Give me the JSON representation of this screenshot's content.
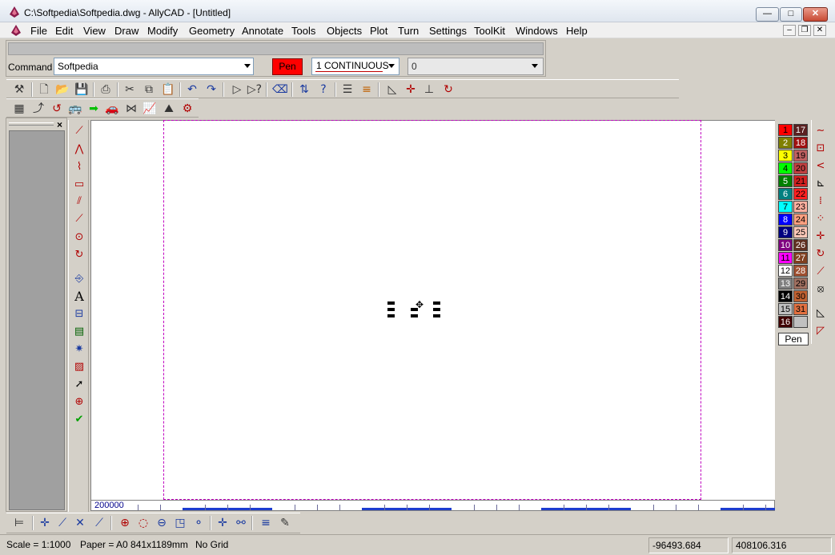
{
  "window": {
    "title": "C:\\Softpedia\\Softpedia.dwg - AllyCAD - [Untitled]",
    "min_glyph": "—",
    "max_glyph": "□",
    "close_glyph": "✕"
  },
  "menu": {
    "items": [
      "File",
      "Edit",
      "View",
      "Draw",
      "Modify",
      "Geometry",
      "Annotate",
      "Tools",
      "Objects",
      "Plot",
      "Turn",
      "Settings",
      "ToolKit",
      "Windows",
      "Help"
    ],
    "mdi_min": "–",
    "mdi_restore": "❐",
    "mdi_close": "✕"
  },
  "command": {
    "label": "Command :",
    "value": "Softpedia",
    "pen_label": "Pen",
    "pen_color": "#ff0000",
    "linetype": "1 CONTINUOUS",
    "layer": "0"
  },
  "toolbar1": {
    "icons": [
      "tools-icon",
      "new-icon",
      "open-icon",
      "save-icon",
      "print-icon",
      "cut-icon",
      "copy-icon",
      "paste-icon",
      "undo-icon",
      "redo-icon",
      "select-icon",
      "select-query-icon",
      "eraser-icon",
      "swap-icon",
      "help-icon",
      "layer-visibility-icon",
      "layer-list-icon",
      "measure-angle-icon",
      "snap-point-icon",
      "snap-corner-icon",
      "refresh-icon"
    ]
  },
  "toolbar2": {
    "icons": [
      "calculator-icon",
      "curve-icon",
      "rotate-icon",
      "vehicle-icon",
      "arrow-right-icon",
      "car-icon",
      "axle-icon",
      "graph-icon",
      "terrain-icon",
      "components-icon"
    ]
  },
  "draw_tools": {
    "icons": [
      "line-icon",
      "polyline-icon",
      "spline-icon",
      "rectangle-icon",
      "parallel-line-icon",
      "offset-line-icon",
      "circle-icon",
      "arc-icon",
      "insert-block-icon",
      "text-icon",
      "dimension-icon",
      "leader-icon",
      "explode-icon",
      "hatch-icon",
      "pointer-icon",
      "zoom-icon",
      "check-icon"
    ],
    "text_glyph": "A"
  },
  "ruler": {
    "label": "200000"
  },
  "palette": {
    "left": [
      {
        "num": "1",
        "color": "#ff0000"
      },
      {
        "num": "2",
        "color": "#808000"
      },
      {
        "num": "3",
        "color": "#ffff00"
      },
      {
        "num": "4",
        "color": "#00ff00"
      },
      {
        "num": "5",
        "color": "#008000"
      },
      {
        "num": "6",
        "color": "#008080"
      },
      {
        "num": "7",
        "color": "#00ffff"
      },
      {
        "num": "8",
        "color": "#0000ff"
      },
      {
        "num": "9",
        "color": "#000080"
      },
      {
        "num": "10",
        "color": "#800080"
      },
      {
        "num": "11",
        "color": "#ff00ff"
      },
      {
        "num": "12",
        "color": "#ffffff"
      },
      {
        "num": "13",
        "color": "#808080"
      },
      {
        "num": "14",
        "color": "#000000"
      },
      {
        "num": "15",
        "color": "#c0c0c0"
      },
      {
        "num": "16",
        "color": "#400000"
      }
    ],
    "right": [
      {
        "num": "17",
        "color": "#5a2020"
      },
      {
        "num": "18",
        "color": "#a01010"
      },
      {
        "num": "19",
        "color": "#c06060"
      },
      {
        "num": "20",
        "color": "#c04040"
      },
      {
        "num": "21",
        "color": "#d02020"
      },
      {
        "num": "22",
        "color": "#ff2020"
      },
      {
        "num": "23",
        "color": "#ffb0a0"
      },
      {
        "num": "24",
        "color": "#ffa080"
      },
      {
        "num": "25",
        "color": "#ffc8b8"
      },
      {
        "num": "26",
        "color": "#603020"
      },
      {
        "num": "27",
        "color": "#804020"
      },
      {
        "num": "28",
        "color": "#a05030"
      },
      {
        "num": "29",
        "color": "#a07060"
      },
      {
        "num": "30",
        "color": "#c06030"
      },
      {
        "num": "31",
        "color": "#e07040"
      },
      {
        "num": "",
        "color": "#c0c0c0"
      }
    ],
    "pen_label": "Pen"
  },
  "modify_tools": {
    "icons": [
      "stretch-icon",
      "move-icon",
      "trim-icon",
      "fillet-icon",
      "chamfer-icon",
      "mirror-icon",
      "array-icon",
      "extend-icon",
      "break-icon",
      "rotate-icon",
      "scale-icon",
      "divide-icon",
      "measure-icon",
      "align-icon"
    ]
  },
  "snap_tools": {
    "icons": [
      "snap-toggle-icon",
      "snap-point-icon",
      "snap-line-icon",
      "snap-intersection-icon",
      "snap-perpendicular-icon",
      "snap-center-icon",
      "snap-quadrant-icon",
      "snap-tangent-icon",
      "snap-midpoint-icon",
      "snap-node-icon",
      "snap-cross-icon",
      "snap-nearest-icon",
      "snap-grid-icon",
      "snap-settings-icon"
    ]
  },
  "status": {
    "scale": "Scale = 1:1000",
    "paper": "Paper = A0 841x1189mm",
    "grid": "No Grid",
    "x": "-96493.684",
    "y": "408106.316"
  }
}
